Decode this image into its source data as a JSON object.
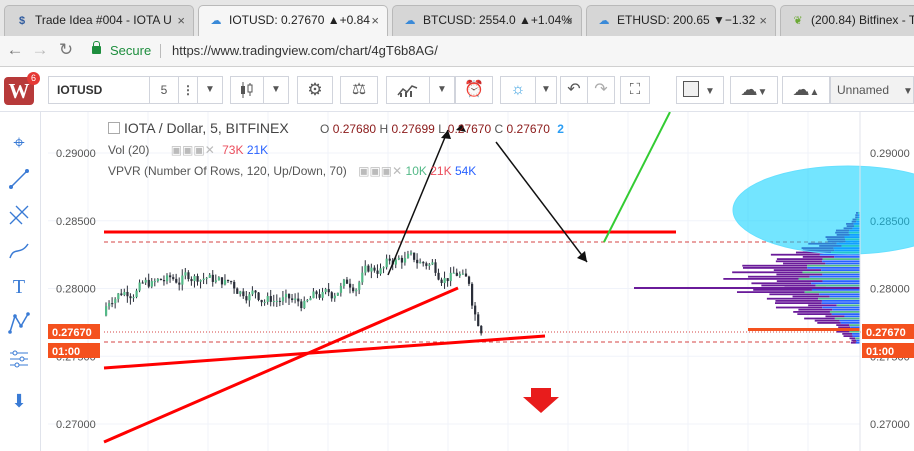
{
  "browser": {
    "tabs": [
      {
        "title": "Trade Idea #004 - IOTA U",
        "icon": "trade-idea-favicon",
        "active": false
      },
      {
        "title": "IOTUSD: 0.27670 ▲+0.84",
        "icon": "tradingview-favicon",
        "active": true
      },
      {
        "title": "BTCUSD: 2554.0 ▲+1.04%",
        "icon": "tradingview-favicon",
        "active": false
      },
      {
        "title": "ETHUSD: 200.65 ▼−1.32",
        "icon": "tradingview-favicon",
        "active": false
      },
      {
        "title": "(200.84) Bitfinex - Tr",
        "icon": "bitfinex-leaf-favicon",
        "active": false
      }
    ],
    "secure_label": "Secure",
    "url_host": "https://www.tradingview.com",
    "url_path": "/chart/4gT6b8AG/"
  },
  "toolbar": {
    "logo_letter": "W",
    "notification_count": "6",
    "symbol": "IOTUSD",
    "interval": "5",
    "layout_name": "Unnamed",
    "icons": [
      "more-vert-icon",
      "candles-icon",
      "settings-gear-icon",
      "compare-scales-icon",
      "indicators-icon",
      "alert-add-icon",
      "idea-bulb-icon",
      "undo-icon",
      "redo-icon",
      "fullscreen-icon",
      "color-square-icon",
      "cloud-download-icon",
      "cloud-upload-icon"
    ]
  },
  "left_tools": [
    "crosshair-icon",
    "trend-line-icon",
    "fib-retracement-icon",
    "brush-icon",
    "text-tool-icon",
    "pattern-icon",
    "measure-icon",
    "arrow-down-icon"
  ],
  "legend": {
    "title": "IOTA / Dollar, 5, BITFINEX",
    "o_label": "O",
    "o": "0.27680",
    "h_label": "H",
    "h": "0.27699",
    "l_label": "L",
    "l": "0.27670",
    "c_label": "C",
    "c": "0.27670",
    "count": "2",
    "vol_label": "Vol (20)",
    "vol_a": "73K",
    "vol_b": "21K",
    "vpvr_label": "VPVR (Number Of Rows, 120, Up/Down, 70)",
    "vpvr_a": "10K",
    "vpvr_b": "21K",
    "vpvr_c": "54K"
  },
  "axis": {
    "ticks": [
      "0.29000",
      "0.28500",
      "0.28000",
      "0.27500",
      "0.27000"
    ],
    "last_price": "0.27670",
    "countdown": "01:00"
  },
  "colors": {
    "up": "#53b987",
    "down": "#eb4d5c",
    "candle_body": "#2a2e39",
    "trendline": "#ff0000",
    "green_line": "#33cc33",
    "ellipse": "#00d0ff",
    "vp_purple": "#6a1b9a",
    "vp_blue": "#2962ff",
    "price_tag": "#f4511e"
  }
}
